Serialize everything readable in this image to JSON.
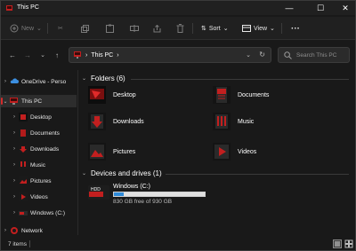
{
  "window": {
    "title": "This PC",
    "controls": {
      "minimize": "—",
      "maximize": "☐",
      "close": "✕"
    }
  },
  "toolbar": {
    "new_label": "New",
    "sort_label": "Sort",
    "view_label": "View",
    "more_label": "···"
  },
  "address": {
    "crumb": "This PC"
  },
  "search": {
    "placeholder": "Search This PC"
  },
  "nav": {
    "items": [
      {
        "label": "OneDrive - Perso",
        "icon": "cloud-icon"
      },
      {
        "label": "This PC",
        "icon": "this-pc-icon"
      },
      {
        "label": "Desktop",
        "icon": "desktop-folder-icon"
      },
      {
        "label": "Documents",
        "icon": "documents-folder-icon"
      },
      {
        "label": "Downloads",
        "icon": "downloads-folder-icon"
      },
      {
        "label": "Music",
        "icon": "music-folder-icon"
      },
      {
        "label": "Pictures",
        "icon": "pictures-folder-icon"
      },
      {
        "label": "Videos",
        "icon": "videos-folder-icon"
      },
      {
        "label": "Windows (C:)",
        "icon": "drive-icon"
      },
      {
        "label": "Network",
        "icon": "network-icon"
      }
    ]
  },
  "folders": {
    "header": "Folders (6)",
    "items": [
      {
        "name": "Desktop",
        "icon": "desktop-folder-icon"
      },
      {
        "name": "Documents",
        "icon": "documents-folder-icon"
      },
      {
        "name": "Downloads",
        "icon": "downloads-folder-icon"
      },
      {
        "name": "Music",
        "icon": "music-folder-icon"
      },
      {
        "name": "Pictures",
        "icon": "pictures-folder-icon"
      },
      {
        "name": "Videos",
        "icon": "videos-folder-icon"
      }
    ]
  },
  "drives": {
    "header": "Devices and drives (1)",
    "items": [
      {
        "name": "Windows (C:)",
        "free": "830 GB free of 930 GB",
        "used_fraction": 0.108,
        "badge": "HDD"
      }
    ]
  },
  "status": {
    "count": "7 items"
  },
  "colors": {
    "accent": "#d52b2b",
    "drive_fill": "#2e8ad8",
    "bg": "#191919"
  }
}
